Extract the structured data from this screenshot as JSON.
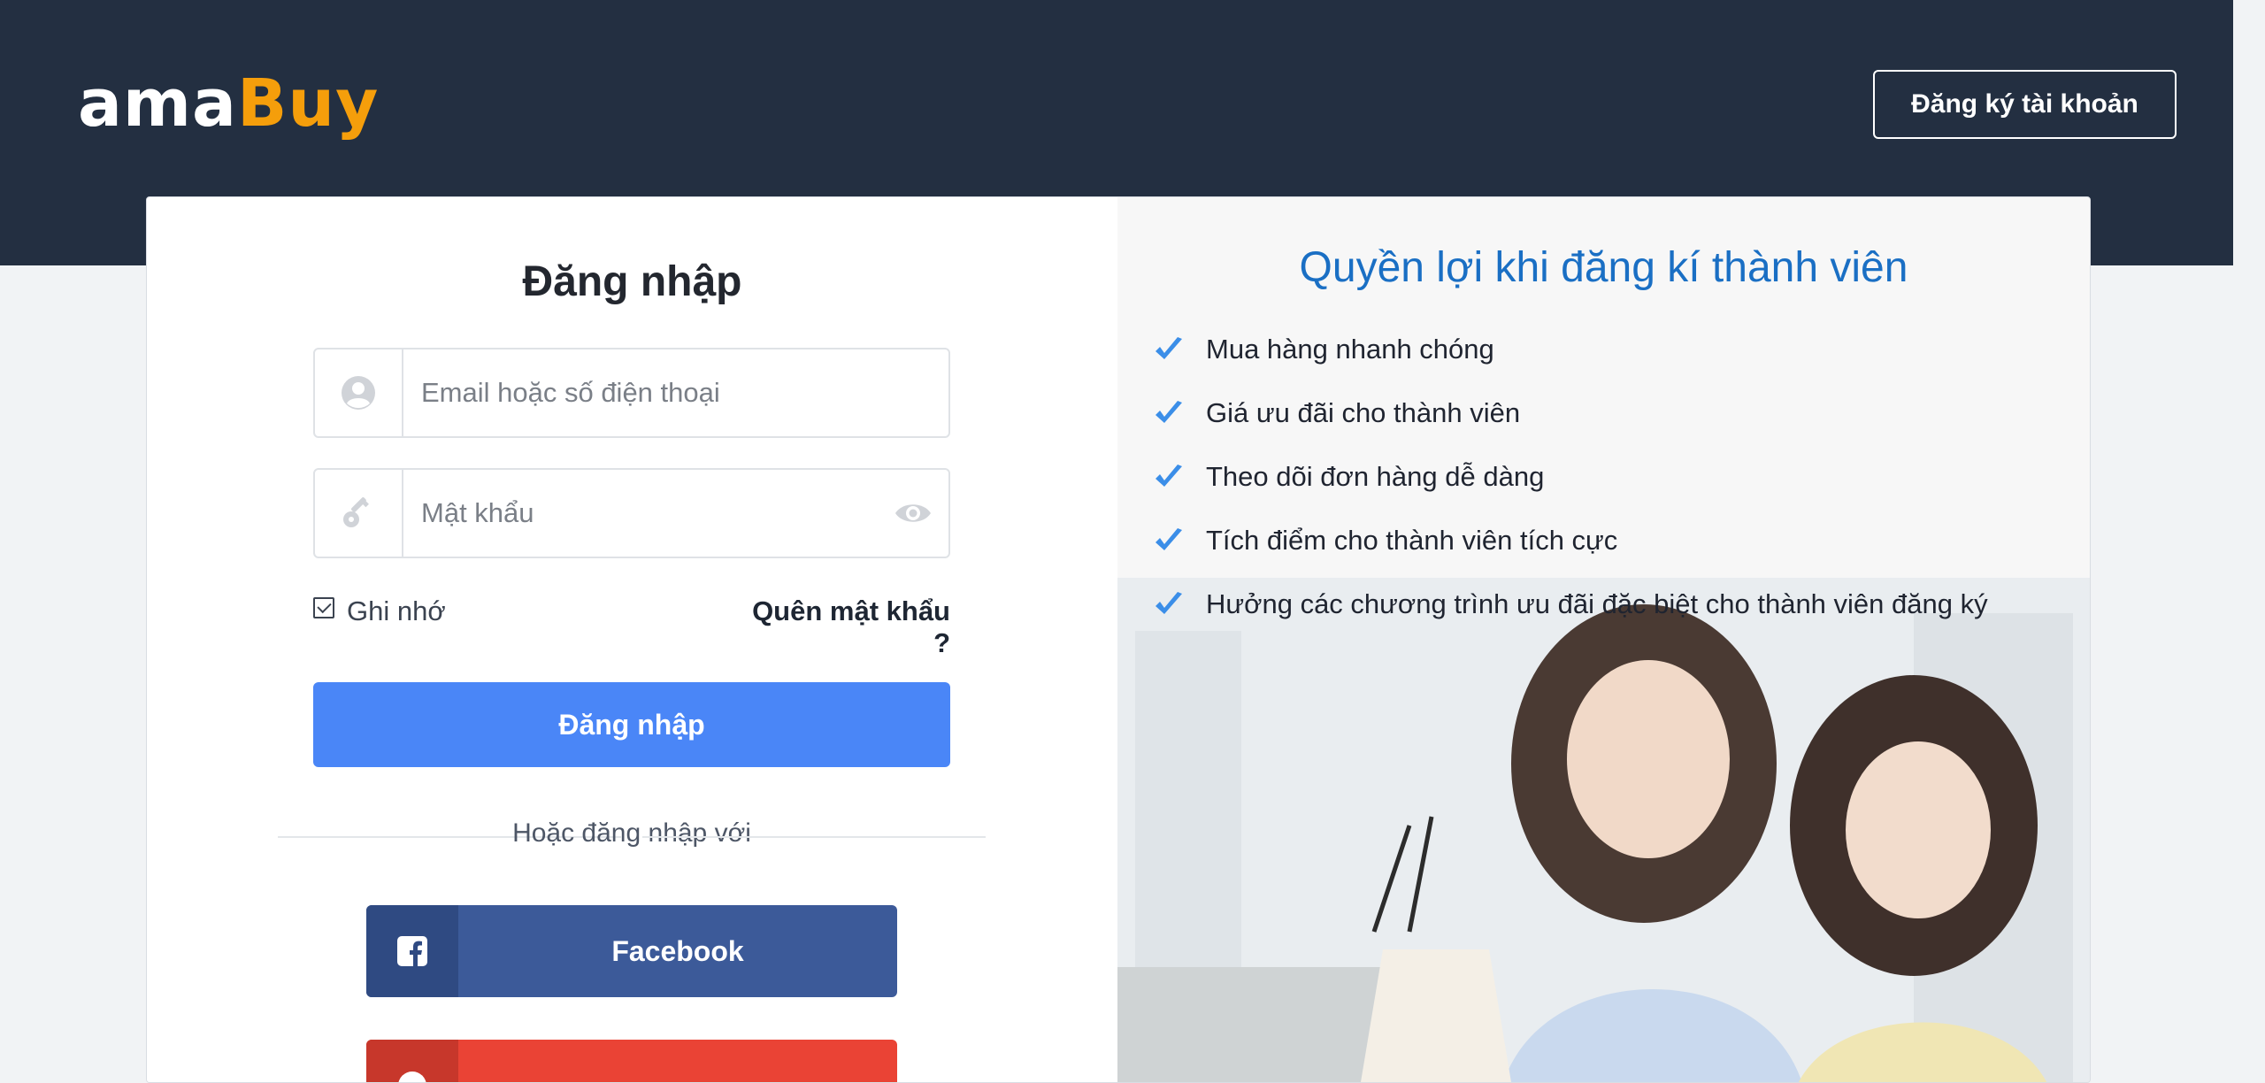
{
  "header": {
    "logo_part1": "ama",
    "logo_part2": "Buy",
    "register_label": "Đăng ký tài khoản"
  },
  "login": {
    "title": "Đăng nhập",
    "email_placeholder": "Email hoặc số điện thoại",
    "password_placeholder": "Mật khẩu",
    "remember_label": "Ghi nhớ",
    "forgot_label": "Quên mật khẩu ?",
    "submit_label": "Đăng nhập",
    "or_label": "Hoặc đăng nhập với",
    "facebook_label": "Facebook"
  },
  "benefits": {
    "title": "Quyền lợi khi đăng kí thành viên",
    "items": [
      "Mua hàng nhanh chóng",
      "Giá ưu đãi cho thành viên",
      "Theo dõi đơn hàng dễ dàng",
      "Tích điểm cho thành viên tích cực",
      "Hưởng các chương trình ưu đãi đặc biệt cho thành viên đăng ký"
    ]
  },
  "colors": {
    "header_bg": "#232f41",
    "brand_accent": "#f59e0b",
    "primary_button": "#4a86f7",
    "facebook": "#3c5a99",
    "google": "#ea4335",
    "check": "#3b8ee8"
  }
}
